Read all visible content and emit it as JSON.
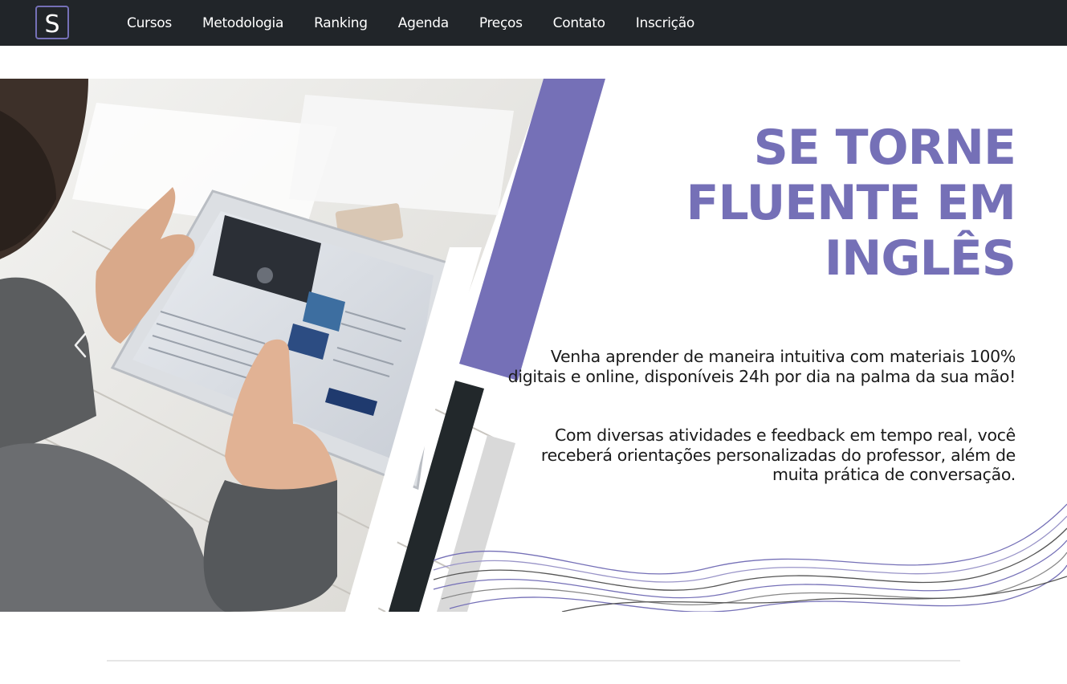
{
  "navbar": {
    "logo_letter": "S",
    "links": [
      "Cursos",
      "Metodologia",
      "Ranking",
      "Agenda",
      "Preços",
      "Contato",
      "Inscrição"
    ]
  },
  "hero": {
    "title": "SE TORNE\nFLUENTE EM\nINGLÊS",
    "paragraph1": "Venha aprender de maneira intuitiva com materiais 100% digitais e online, disponíveis 24h por dia na palma da sua mão!",
    "paragraph2": "Com diversas atividades e feedback em tempo real, você receberá orientações personalizadas do professor, além de muita prática de conversação.",
    "prev_icon": "chevron-left-icon"
  },
  "colors": {
    "navbar_bg": "#212529",
    "accent_purple": "#7570b7",
    "dark_stripe": "#22282b",
    "gray_stripe": "#d9d9d9"
  }
}
